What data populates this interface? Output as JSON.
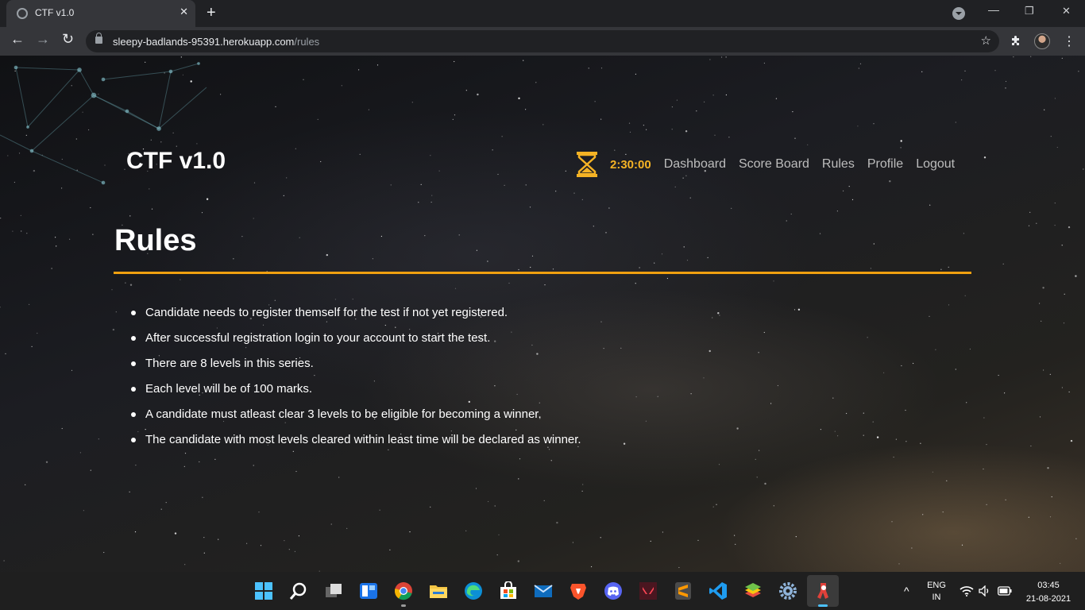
{
  "browser": {
    "tab_title": "CTF v1.0",
    "tab_close": "✕",
    "new_tab": "+",
    "url_host": "sleepy-badlands-95391.herokuapp.com",
    "url_path": "/rules"
  },
  "site": {
    "brand": "CTF v1.0",
    "timer": "2:30:00",
    "nav": [
      "Dashboard",
      "Score Board",
      "Rules",
      "Profile",
      "Logout"
    ],
    "accent_color": "#f5b325"
  },
  "main": {
    "title": "Rules",
    "rules": [
      "Candidate needs to register themself for the test if not yet registered.",
      "After successful registration login to your account to start the test.",
      "There are 8 levels in this series.",
      "Each level will be of 100 marks.",
      "A candidate must atleast clear 3 levels to be eligible for becoming a winner.",
      "The candidate with most levels cleared within least time will be declared as winner."
    ]
  },
  "taskbar": {
    "lang": "ENG",
    "region": "IN",
    "time": "03:45",
    "date": "21-08-2021",
    "apps": [
      "start-icon",
      "search-icon",
      "task-view-icon",
      "widgets-icon",
      "chrome-icon",
      "file-explorer-icon",
      "edge-icon",
      "store-icon",
      "mail-icon",
      "brave-icon",
      "discord-icon",
      "valorant-icon",
      "sublime-icon",
      "vscode-icon",
      "bluestacks-icon",
      "settings-icon",
      "app-icon"
    ]
  }
}
